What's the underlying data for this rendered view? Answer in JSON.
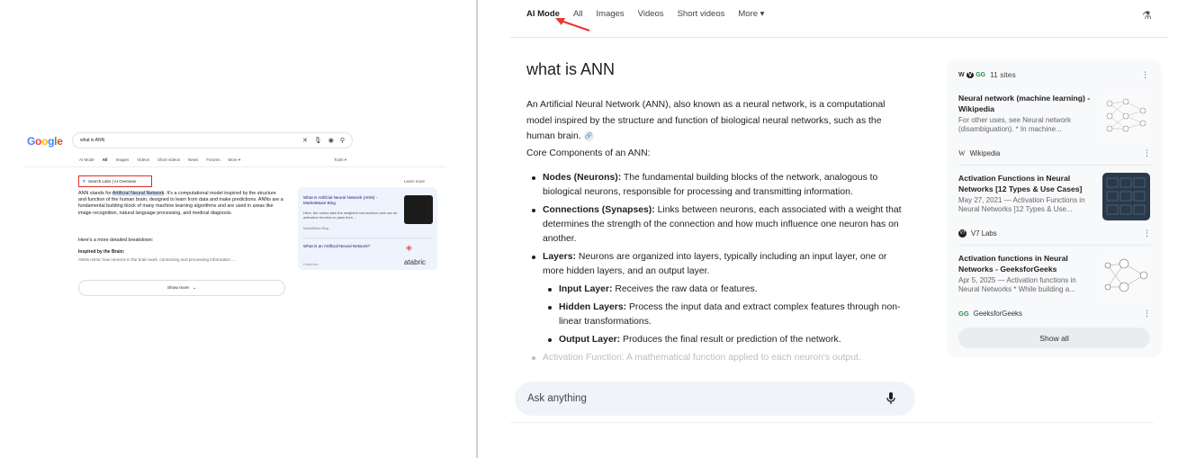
{
  "left": {
    "logo": [
      "G",
      "o",
      "o",
      "g",
      "l",
      "e"
    ],
    "search_value": "what is ANN",
    "tabs": [
      "AI Mode",
      "All",
      "Images",
      "Videos",
      "Short videos",
      "News",
      "Forums",
      "More ▾"
    ],
    "active_tab": "All",
    "tools": "Tools ▾",
    "labs_label": "Search Labs | AI Overview",
    "learn_more": "Learn more",
    "overview_before": "ANN stands for ",
    "overview_highlight": "Artificial Neural Network",
    "overview_after": ". It's a computational model inspired by the structure and function of the human brain, designed to learn from data and make predictions. ANNs are a fundamental building block of many machine learning algorithms and are used in areas like image recognition, natural language processing, and medical diagnosis.",
    "breakdown": "Here's a more detailed breakdown:",
    "inspired_title": "Inspired by the Brain:",
    "inspired_text": "ANNs mimic how neurons in the brain work, connecting and processing information ...",
    "card": {
      "title1": "What is Artificial Neural Network (ANN) - MarketMuse Blog",
      "desc1": "Here, the nodes take the weighted connections and use an activation function to pass their ...",
      "site1": "MarketMuse Blog",
      "title2": "What is an Artificial Neural Network?",
      "brand": "atabric",
      "site2": "Databricks"
    },
    "show_more": "Show more"
  },
  "right": {
    "tabs": [
      "AI Mode",
      "All",
      "Images",
      "Videos",
      "Short videos",
      "More ▾"
    ],
    "active_tab": "AI Mode",
    "title": "what is ANN",
    "intro": "An Artificial Neural Network (ANN), also known as a neural network, is a computational model inspired by the structure and function of biological neural networks, such as the human brain.",
    "core_heading": "Core Components of an ANN:",
    "items": [
      {
        "term": "Nodes (Neurons):",
        "text": " The fundamental building blocks of the network, analogous to biological neurons, responsible for processing and transmitting information."
      },
      {
        "term": "Connections (Synapses):",
        "text": " Links between neurons, each associated with a weight that determines the strength of the connection and how much influence one neuron has on another."
      },
      {
        "term": "Layers:",
        "text": " Neurons are organized into layers, typically including an input layer, one or more hidden layers, and an output layer."
      }
    ],
    "subitems": [
      {
        "term": "Input Layer:",
        "text": " Receives the raw data or features."
      },
      {
        "term": "Hidden Layers:",
        "text": " Process the input data and extract complex features through non-linear transformations."
      },
      {
        "term": "Output Layer:",
        "text": " Produces the final result or prediction of the network."
      }
    ],
    "faded": {
      "term": "Activation Function:",
      "text": " A mathematical function applied to each neuron's output."
    },
    "ask_placeholder": "Ask anything",
    "sources": {
      "count": "11 sites",
      "items": [
        {
          "title": "Neural network (machine learning) - Wikipedia",
          "desc": "For other uses, see Neural network (disambiguation). * In machine...",
          "site": "Wikipedia"
        },
        {
          "title": "Activation Functions in Neural Networks [12 Types & Use Cases]",
          "desc": "May 27, 2021 — Activation Functions in Neural Networks [12 Types & Use...",
          "site": "V7 Labs"
        },
        {
          "title": "Activation functions in Neural Networks - GeeksforGeeks",
          "desc": "Apr 5, 2025 — Activation functions in Neural Networks * While building a...",
          "site": "GeeksforGeeks"
        }
      ],
      "show_all": "Show all"
    }
  }
}
